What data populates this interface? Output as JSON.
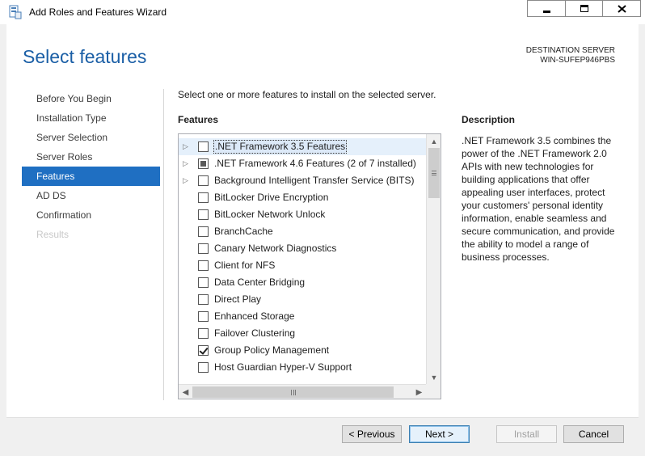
{
  "window": {
    "title": "Add Roles and Features Wizard",
    "controls": [
      "minimize-icon",
      "maximize-icon",
      "close-icon"
    ]
  },
  "page": {
    "title": "Select features",
    "destination_label": "DESTINATION SERVER",
    "destination_value": "WIN-SUFEP946PBS",
    "instruction": "Select one or more features to install on the selected server."
  },
  "nav": {
    "items": [
      {
        "label": "Before You Begin",
        "state": "normal"
      },
      {
        "label": "Installation Type",
        "state": "normal"
      },
      {
        "label": "Server Selection",
        "state": "normal"
      },
      {
        "label": "Server Roles",
        "state": "normal"
      },
      {
        "label": "Features",
        "state": "active"
      },
      {
        "label": "AD DS",
        "state": "normal"
      },
      {
        "label": "Confirmation",
        "state": "normal"
      },
      {
        "label": "Results",
        "state": "disabled"
      }
    ]
  },
  "features": {
    "heading": "Features",
    "items": [
      {
        "label": ".NET Framework 3.5 Features",
        "expandable": true,
        "check": "unchecked",
        "selected": true
      },
      {
        "label": ".NET Framework 4.6 Features (2 of 7 installed)",
        "expandable": true,
        "check": "partial",
        "selected": false
      },
      {
        "label": "Background Intelligent Transfer Service (BITS)",
        "expandable": true,
        "check": "unchecked",
        "selected": false
      },
      {
        "label": "BitLocker Drive Encryption",
        "expandable": false,
        "check": "unchecked",
        "selected": false
      },
      {
        "label": "BitLocker Network Unlock",
        "expandable": false,
        "check": "unchecked",
        "selected": false
      },
      {
        "label": "BranchCache",
        "expandable": false,
        "check": "unchecked",
        "selected": false
      },
      {
        "label": "Canary Network Diagnostics",
        "expandable": false,
        "check": "unchecked",
        "selected": false
      },
      {
        "label": "Client for NFS",
        "expandable": false,
        "check": "unchecked",
        "selected": false
      },
      {
        "label": "Data Center Bridging",
        "expandable": false,
        "check": "unchecked",
        "selected": false
      },
      {
        "label": "Direct Play",
        "expandable": false,
        "check": "unchecked",
        "selected": false
      },
      {
        "label": "Enhanced Storage",
        "expandable": false,
        "check": "unchecked",
        "selected": false
      },
      {
        "label": "Failover Clustering",
        "expandable": false,
        "check": "unchecked",
        "selected": false
      },
      {
        "label": "Group Policy Management",
        "expandable": false,
        "check": "checked",
        "selected": false
      },
      {
        "label": "Host Guardian Hyper-V Support",
        "expandable": false,
        "check": "unchecked",
        "selected": false
      }
    ]
  },
  "description": {
    "heading": "Description",
    "text": ".NET Framework 3.5 combines the power of the .NET Framework 2.0 APIs with new technologies for building applications that offer appealing user interfaces, protect your customers' personal identity information, enable seamless and secure communication, and provide the ability to model a range of business processes."
  },
  "buttons": {
    "previous": "< Previous",
    "next": "Next >",
    "install": "Install",
    "cancel": "Cancel"
  },
  "colors": {
    "title_blue": "#1b5fa6",
    "nav_active": "#1f6fc2"
  }
}
